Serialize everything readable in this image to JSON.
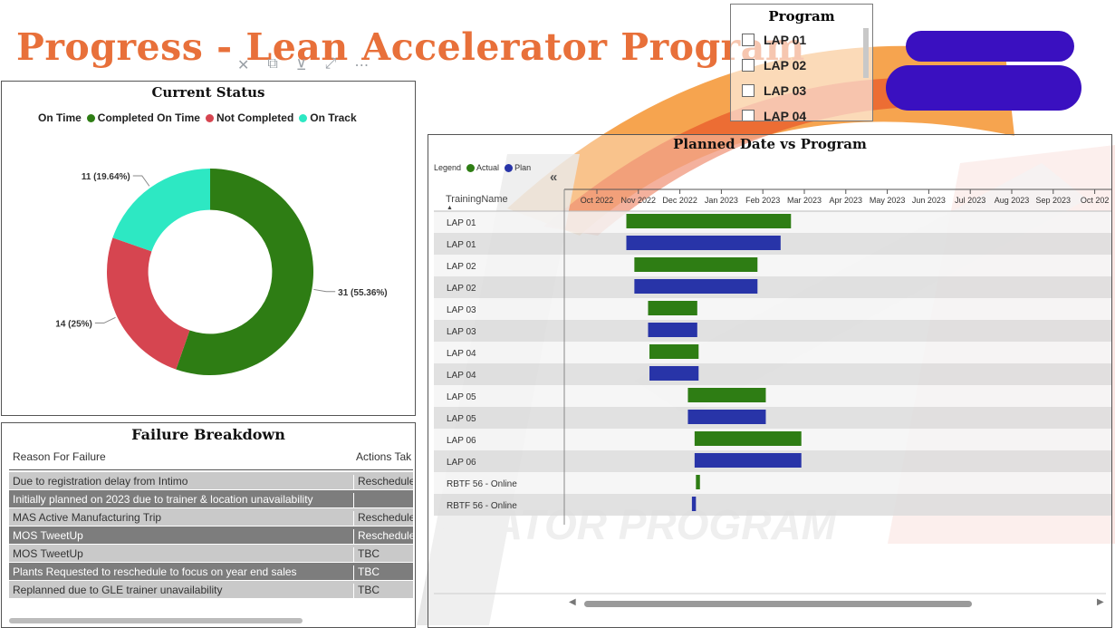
{
  "page": {
    "title": "Progress - Lean Accelerator Program",
    "watermark_text": "ERATOR PROGRAM"
  },
  "slicer": {
    "title": "Program",
    "items": [
      "LAP 01",
      "LAP 02",
      "LAP 03",
      "LAP 04"
    ]
  },
  "colors": {
    "title_orange": "#e8703a",
    "actual_green": "#2e7d14",
    "plan_blue": "#2834a8",
    "not_completed_red": "#d64550",
    "on_track_teal": "#2de8c3",
    "redaction_purple": "#3a10c0"
  },
  "current_status": {
    "title": "Current Status",
    "legend": [
      {
        "label": "On Time",
        "color": ""
      },
      {
        "label": "Completed On Time",
        "color": "#2e7d14"
      },
      {
        "label": "Not Completed",
        "color": "#d64550"
      },
      {
        "label": "On Track",
        "color": "#2de8c3"
      }
    ]
  },
  "failure_breakdown": {
    "title": "Failure Breakdown",
    "headers": [
      "Reason For Failure",
      "Actions Tak"
    ],
    "rows": [
      [
        "Due to registration delay from Intimo",
        "Reschedule"
      ],
      [
        "Initially planned on 2023 due to trainer & location unavailability",
        ""
      ],
      [
        "MAS Active Manufacturing Trip",
        "Reschedule"
      ],
      [
        "MOS TweetUp",
        "Reschedule"
      ],
      [
        "MOS TweetUp",
        "TBC"
      ],
      [
        "Plants Requested to reschedule to focus on year end sales",
        "TBC"
      ],
      [
        "Replanned due to GLE trainer unavailability",
        "TBC"
      ]
    ]
  },
  "gantt": {
    "title": "Planned Date vs Program",
    "legend_label": "Legend",
    "column_header": "TrainingName",
    "collapse_icon": "«",
    "sort_icon": "▲",
    "scroll_left_icon": "◀",
    "scroll_right_icon": "▶"
  },
  "chart_data": [
    {
      "type": "pie",
      "title": "Current Status",
      "categories": [
        "Completed On Time",
        "Not Completed",
        "On Track"
      ],
      "values": [
        31,
        14,
        11
      ],
      "percents": [
        55.36,
        25,
        19.64
      ],
      "data_labels": [
        "31 (55.36%)",
        "14 (25%)",
        "11 (19.64%)"
      ],
      "colors": [
        "#2e7d14",
        "#d64550",
        "#2de8c3"
      ],
      "hole": 0.6
    },
    {
      "type": "bar",
      "orientation": "horizontal-gantt",
      "title": "Planned Date vs Program",
      "x_ticks": [
        "Oct 2022",
        "Nov 2022",
        "Dec 2022",
        "Jan 2023",
        "Feb 2023",
        "Mar 2023",
        "Apr 2023",
        "May 2023",
        "Jun 2023",
        "Jul 2023",
        "Aug 2023",
        "Sep 2023",
        "Oct 202"
      ],
      "series": [
        {
          "name": "Actual",
          "color": "#2e7d14"
        },
        {
          "name": "Plan",
          "color": "#2834a8"
        }
      ],
      "rows": [
        {
          "label": "LAP 01",
          "series": "Actual",
          "start": "2022-10-23",
          "end": "2023-02-20"
        },
        {
          "label": "LAP 01",
          "series": "Plan",
          "start": "2022-10-23",
          "end": "2023-02-13"
        },
        {
          "label": "LAP 02",
          "series": "Actual",
          "start": "2022-10-29",
          "end": "2023-01-28"
        },
        {
          "label": "LAP 02",
          "series": "Plan",
          "start": "2022-10-29",
          "end": "2023-01-28"
        },
        {
          "label": "LAP 03",
          "series": "Actual",
          "start": "2022-11-08",
          "end": "2022-12-14"
        },
        {
          "label": "LAP 03",
          "series": "Plan",
          "start": "2022-11-08",
          "end": "2022-12-14"
        },
        {
          "label": "LAP 04",
          "series": "Actual",
          "start": "2022-11-09",
          "end": "2022-12-15"
        },
        {
          "label": "LAP 04",
          "series": "Plan",
          "start": "2022-11-09",
          "end": "2022-12-15"
        },
        {
          "label": "LAP 05",
          "series": "Actual",
          "start": "2022-12-07",
          "end": "2023-02-03"
        },
        {
          "label": "LAP 05",
          "series": "Plan",
          "start": "2022-12-07",
          "end": "2023-02-03"
        },
        {
          "label": "LAP 06",
          "series": "Actual",
          "start": "2022-12-12",
          "end": "2023-02-27"
        },
        {
          "label": "LAP 06",
          "series": "Plan",
          "start": "2022-12-12",
          "end": "2023-02-27"
        },
        {
          "label": "RBTF 56 - Online",
          "series": "Actual",
          "start": "2022-12-13",
          "end": "2022-12-16"
        },
        {
          "label": "RBTF 56 - Online",
          "series": "Plan",
          "start": "2022-12-10",
          "end": "2022-12-13"
        }
      ]
    }
  ]
}
